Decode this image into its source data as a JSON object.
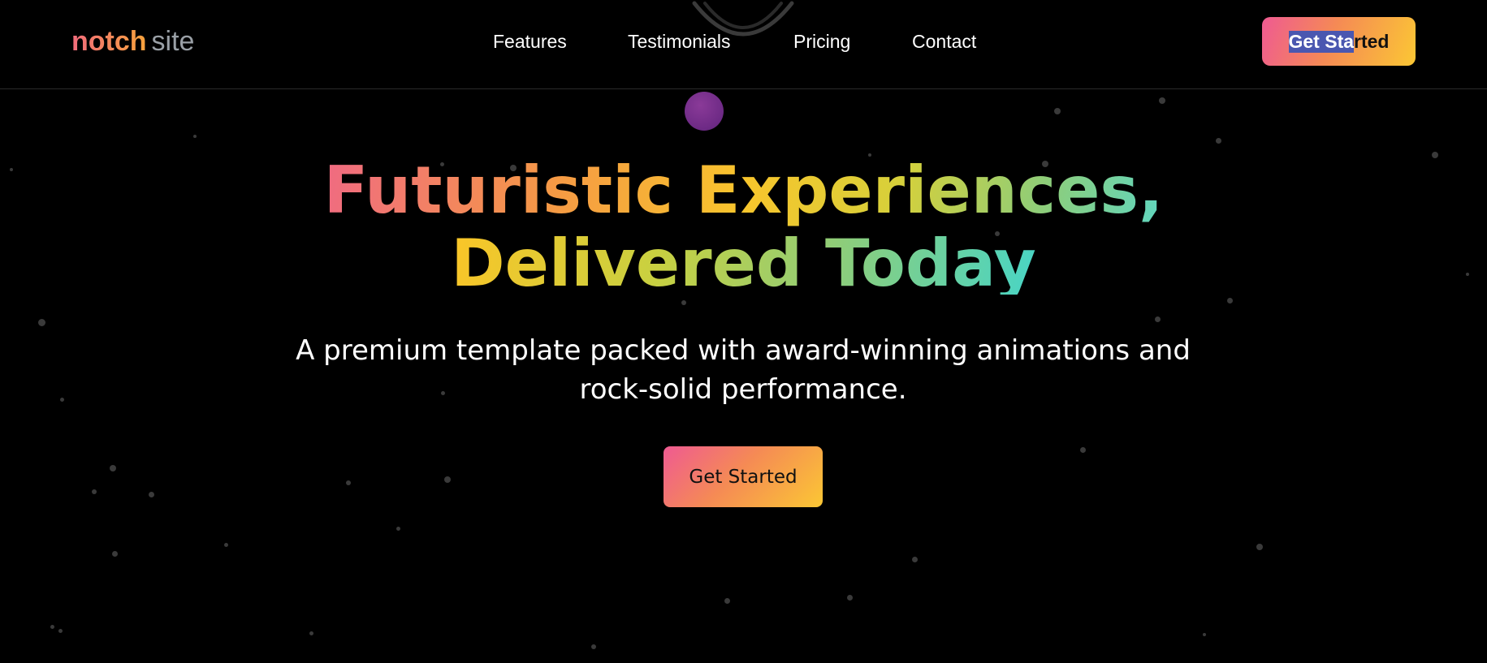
{
  "header": {
    "logo": {
      "bold": "notch",
      "light": "site"
    },
    "nav": [
      {
        "label": "Features"
      },
      {
        "label": "Testimonials"
      },
      {
        "label": "Pricing"
      },
      {
        "label": "Contact"
      }
    ],
    "cta": {
      "selected_part": "Get Sta",
      "rest": "rted"
    }
  },
  "hero": {
    "title_line1": "Futuristic Experiences,",
    "title_line2": "Delivered Today",
    "subtitle": "A premium template packed with award-winning animations and rock-solid performance.",
    "cta_label": "Get Started"
  },
  "colors": {
    "background": "#000000",
    "gradient_pink": "#ef5a92",
    "gradient_orange": "#f58a55",
    "gradient_yellow": "#fbc734",
    "gradient_teal": "#48d5c6",
    "orb_purple": "#6d2a85",
    "selection_blue": "#4a57b0"
  }
}
